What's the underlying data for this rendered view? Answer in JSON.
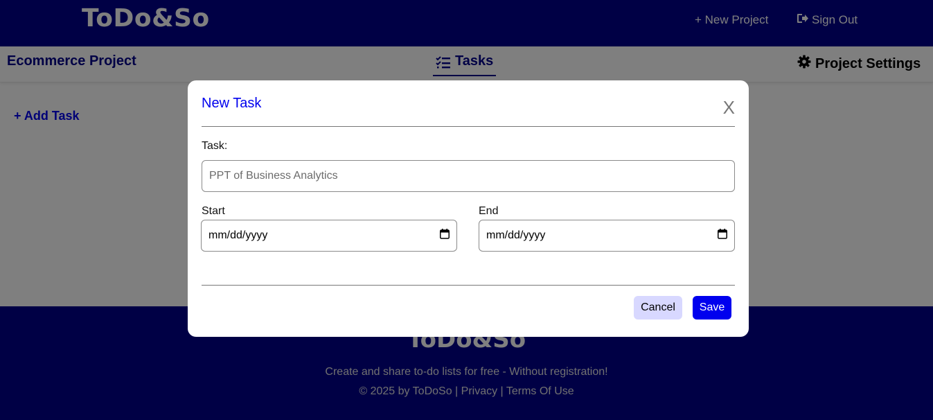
{
  "header": {
    "logo": "ToDo&So",
    "new_project": "+ New Project",
    "sign_out": "Sign Out"
  },
  "subbar": {
    "project_name": "Ecommerce Project",
    "tasks_tab": "Tasks",
    "settings_tab": "Project Settings"
  },
  "main": {
    "add_task": "+ Add Task"
  },
  "modal": {
    "title": "New Task",
    "close": "X",
    "task_label": "Task:",
    "task_placeholder": "PPT of Business Analytics",
    "start_label": "Start",
    "start_value": "mm/dd/yyyy",
    "end_label": "End",
    "end_value": "mm/dd/yyyy",
    "cancel": "Cancel",
    "save": "Save"
  },
  "footer": {
    "logo": "ToDo&So",
    "tagline": "Create and share to-do lists for free - Without registration!",
    "copyright": "© 2025 by ToDoSo",
    "sep": " | ",
    "privacy": "Privacy",
    "terms": "Terms Of Use"
  },
  "colors": {
    "brand_navy": "#00008b",
    "accent_blue": "#0000ee",
    "cancel_bg": "#d8d8ff"
  },
  "icons": {
    "sign_out": "sign-out-icon",
    "tasks": "task-list-icon",
    "settings": "gear-icon",
    "calendar": "calendar-icon"
  }
}
